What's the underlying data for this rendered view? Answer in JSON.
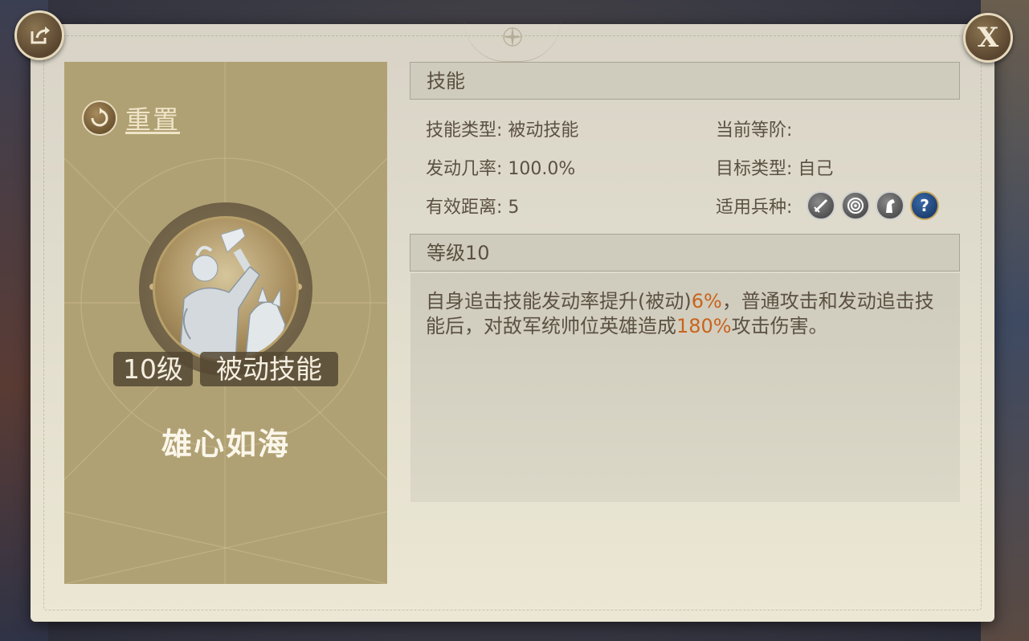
{
  "header": {
    "share_icon": "share-export-icon",
    "close_label": "X"
  },
  "left_card": {
    "reset_label": "重置",
    "level_tag": "10级",
    "type_tag": "被动技能",
    "skill_name": "雄心如海"
  },
  "skill_section": {
    "title": "技能",
    "skill_type": {
      "label": "技能类型:",
      "value": "被动技能"
    },
    "current_rank": {
      "label": "当前等阶:",
      "value": ""
    },
    "trigger_rate": {
      "label": "发动几率:",
      "value": "100.0%"
    },
    "target_type": {
      "label": "目标类型:",
      "value": "自己"
    },
    "range": {
      "label": "有效距离:",
      "value": "5"
    },
    "troop_types": {
      "label": "适用兵种:",
      "icons": [
        "sword-icon",
        "bow-target-icon",
        "horse-icon",
        "question-icon"
      ]
    }
  },
  "level_section": {
    "title": "等级10",
    "desc_part1": "自身追击技能发动率提升(被动)",
    "desc_hl1": "6%",
    "desc_part2": "，普通攻击和发动追击技能后，对敌军统帅位英雄造成",
    "desc_hl2": "180%",
    "desc_part3": "攻击伤害。"
  },
  "colors": {
    "highlight": "#c9641c",
    "left_card_bg": "#b0a174",
    "panel_bg": "#e0dccd"
  }
}
